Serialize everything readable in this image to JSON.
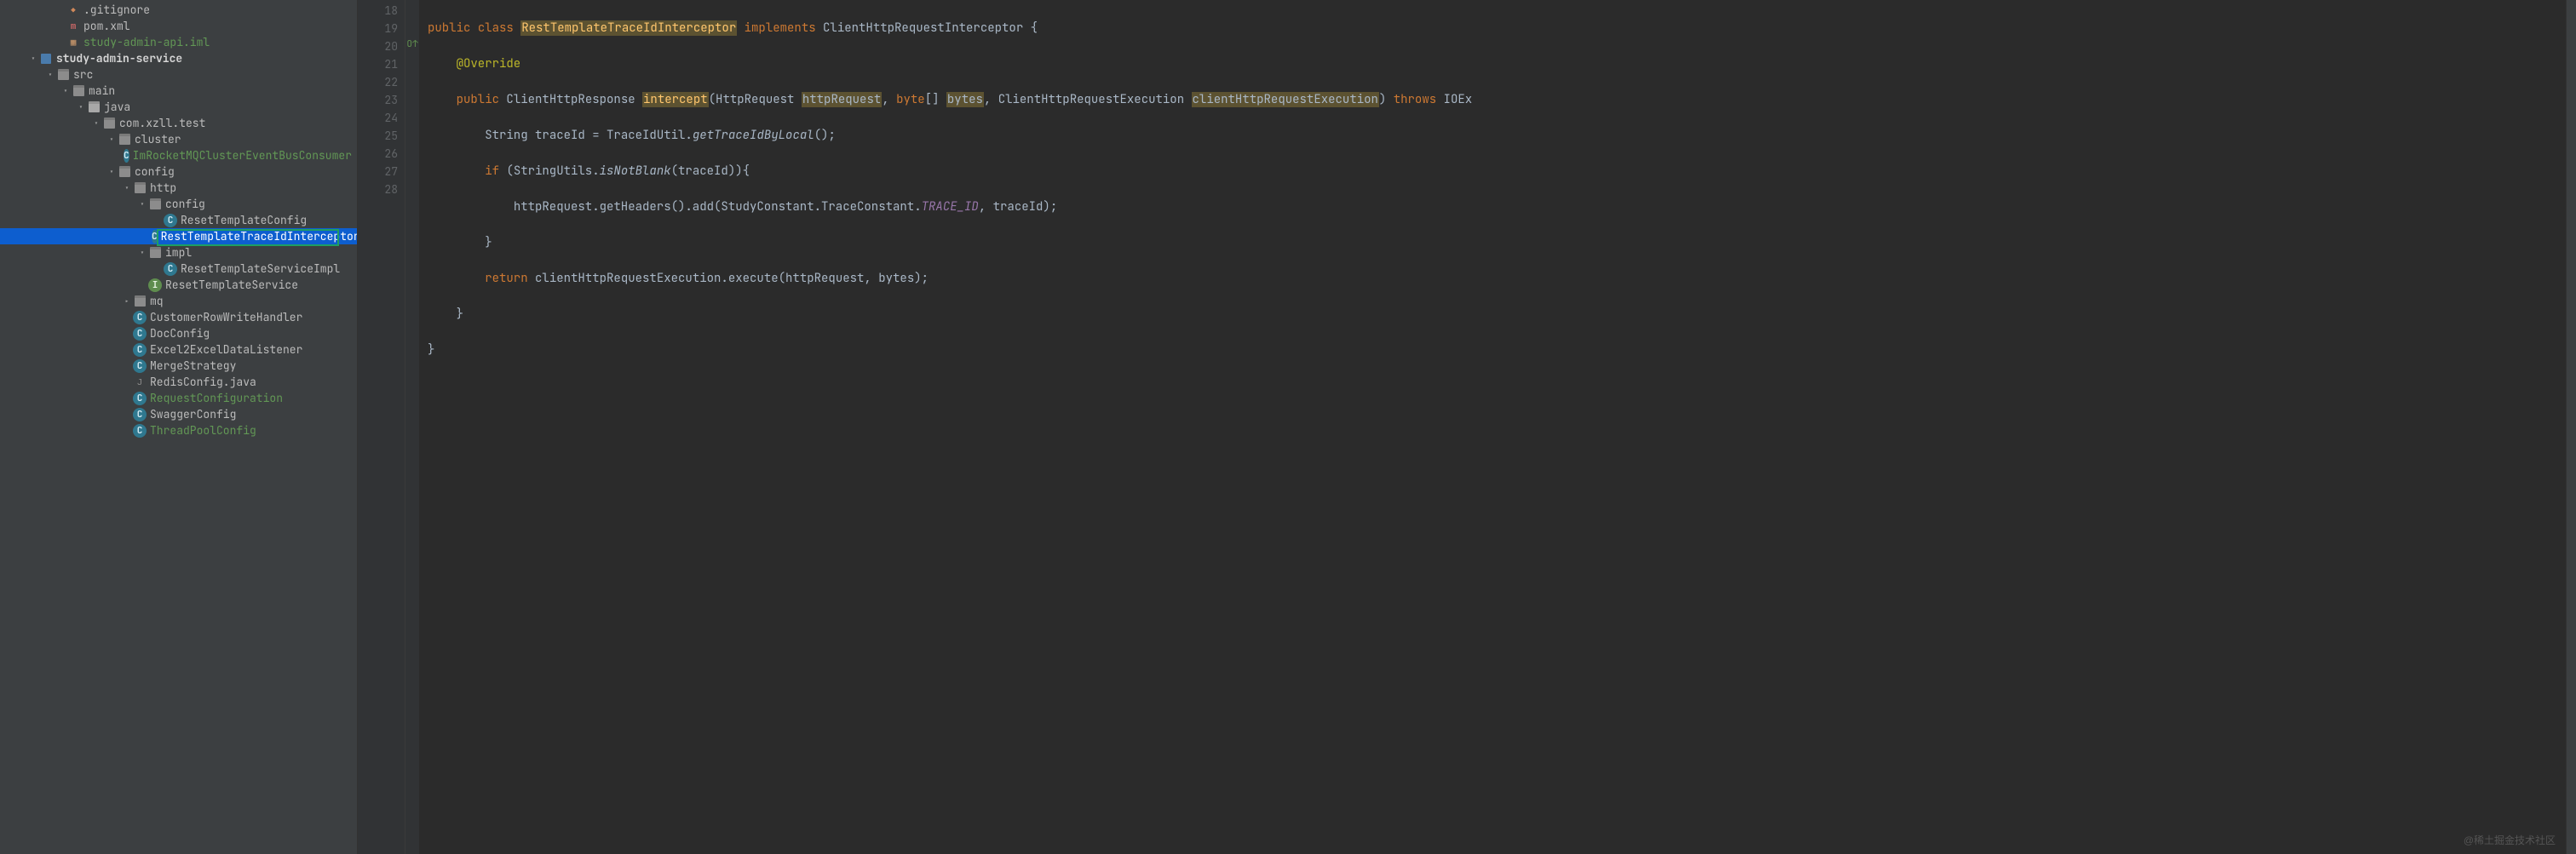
{
  "watermark": "@稀土掘金技术社区",
  "tree": {
    "gitignore": ".gitignore",
    "pom": "pom.xml",
    "iml": "study-admin-api.iml",
    "module": "study-admin-service",
    "src": "src",
    "main": "main",
    "java": "java",
    "package": "com.xzll.test",
    "cluster": "cluster",
    "cluster_item": "ImRocketMQClusterEventBusConsumer",
    "config": "config",
    "http": "http",
    "http_config": "config",
    "reset_template_config": "ResetTemplateConfig",
    "rest_interceptor": "RestTemplateTraceIdInterceptor",
    "impl": "impl",
    "reset_template_service_impl": "ResetTemplateServiceImpl",
    "reset_template_service": "ResetTemplateService",
    "mq": "mq",
    "customer_row": "CustomerRowWriteHandler",
    "doc_config": "DocConfig",
    "excel_listener": "Excel2ExcelDataListener",
    "merge_strategy": "MergeStrategy",
    "redis_config": "RedisConfig.java",
    "request_config": "RequestConfiguration",
    "swagger_config": "SwaggerConfig",
    "threadpool_config": "ThreadPoolConfig"
  },
  "gutter": {
    "start": 18,
    "end": 28,
    "markers": {
      "20": "O↑"
    }
  },
  "code": {
    "l18": {
      "pub": "public ",
      "cls": "class ",
      "name": "RestTemplateTraceIdInterceptor",
      "impl": " implements ",
      "iface": "ClientHttpRequestInterceptor",
      "tail": " {"
    },
    "l19": {
      "anno": "@Override"
    },
    "l20": {
      "pub": "public ",
      "ret": "ClientHttpResponse ",
      "m": "intercept",
      "open": "(",
      "t1": "HttpRequest ",
      "p1": "httpRequest",
      "c1": ", ",
      "t2": "byte",
      "arr": "[] ",
      "p2": "bytes",
      "c2": ", ",
      "t3": "ClientHttpRequestExecution ",
      "p3": "clientHttpRequestExecution",
      "close": ") ",
      "thr": "throws ",
      "ex": "IOEx"
    },
    "l21": {
      "t": "String ",
      "v": "traceId",
      "eq": " = ",
      "cls": "TraceIdUtil.",
      "call": "getTraceIdByLocal",
      "tail": "();"
    },
    "l22": {
      "kw": "if ",
      "open": "(",
      "cls": "StringUtils.",
      "call": "isNotBlank",
      "arg": "(traceId)){"
    },
    "l23": {
      "obj": "httpRequest.getHeaders().add(StudyConstant.TraceConstant.",
      "const": "TRACE_ID",
      "tail": ", traceId);"
    },
    "l24": {
      "brace": "}"
    },
    "l25": {
      "kw": "return ",
      "call": "clientHttpRequestExecution.execute(httpRequest, bytes);"
    },
    "l26": {
      "brace": "}"
    },
    "l27": {
      "brace": "}"
    }
  }
}
